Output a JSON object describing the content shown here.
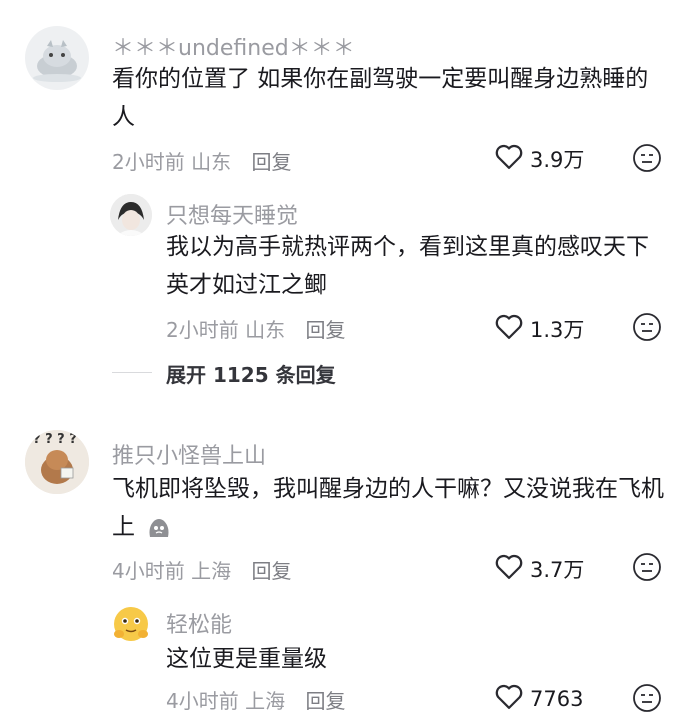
{
  "comments": [
    {
      "username": "＊＊＊undefined＊＊＊",
      "text": "看你的位置了 如果你在副驾驶一定要叫醒身边熟睡的人",
      "time": "2小时前",
      "location": "山东",
      "reply_label": "回复",
      "likes": "3.9万",
      "replies": [
        {
          "username": "只想每天睡觉",
          "text": "我以为高手就热评两个，看到这里真的感叹天下英才如过江之鲫",
          "time": "2小时前",
          "location": "山东",
          "reply_label": "回复",
          "likes": "1.3万"
        }
      ],
      "expand_label": "展开 1125 条回复"
    },
    {
      "username": "推只小怪兽上山",
      "avatar_label": "? ? ? ?",
      "text": "飞机即将坠毁，我叫醒身边的人干嘛？又没说我在飞机上",
      "time": "4小时前",
      "location": "上海",
      "reply_label": "回复",
      "likes": "3.7万",
      "replies": [
        {
          "username": "轻松能",
          "text": "这位更是重量级",
          "time": "4小时前",
          "location": "上海",
          "reply_label": "回复",
          "likes": "7763"
        }
      ]
    }
  ],
  "colors": {
    "meta": "#9a9ba1",
    "text": "#1a1a1f",
    "background": "#ffffff"
  }
}
